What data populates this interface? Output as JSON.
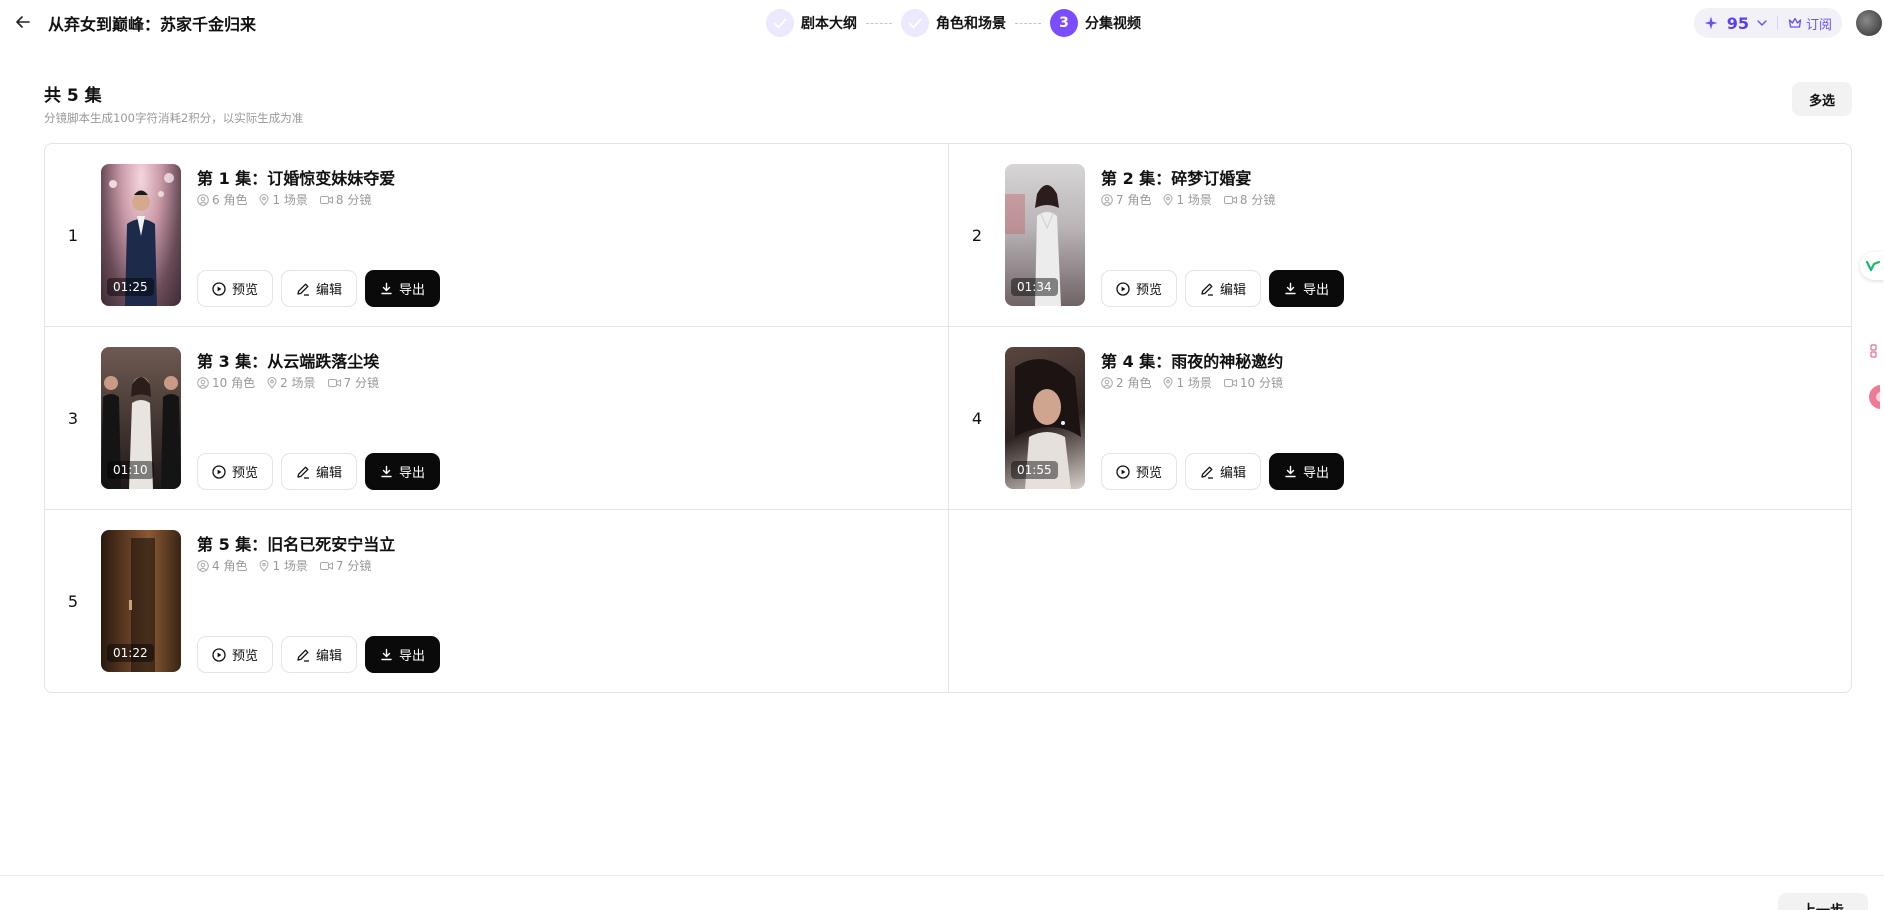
{
  "header": {
    "title": "从弃女到巅峰：苏家千金归来",
    "steps": [
      {
        "label": "剧本大纲",
        "status": "done"
      },
      {
        "label": "角色和场景",
        "status": "done"
      },
      {
        "label": "分集视频",
        "number": "3",
        "status": "active"
      }
    ],
    "credits": "95",
    "subscribe_label": "订阅",
    "accent_color": "#7c4dff"
  },
  "summary": {
    "title": "共 5 集",
    "subtitle": "分镜脚本生成100字符消耗2积分，以实际生成为准",
    "multi_select_label": "多选"
  },
  "buttons": {
    "preview": "预览",
    "edit": "编辑",
    "export": "导出"
  },
  "episodes": [
    {
      "num": "1",
      "title": "第 1 集：订婚惊变妹妹夺爱",
      "roles": "6 角色",
      "scenes": "1 场景",
      "shots": "8 分镜",
      "duration": "01:25"
    },
    {
      "num": "2",
      "title": "第 2 集：碎梦订婚宴",
      "roles": "7 角色",
      "scenes": "1 场景",
      "shots": "8 分镜",
      "duration": "01:34"
    },
    {
      "num": "3",
      "title": "第 3 集：从云端跌落尘埃",
      "roles": "10 角色",
      "scenes": "2 场景",
      "shots": "7 分镜",
      "duration": "01:10"
    },
    {
      "num": "4",
      "title": "第 4 集：雨夜的神秘邀约",
      "roles": "2 角色",
      "scenes": "1 场景",
      "shots": "10 分镜",
      "duration": "01:55"
    },
    {
      "num": "5",
      "title": "第 5 集：旧名已死安宁当立",
      "roles": "4 角色",
      "scenes": "1 场景",
      "shots": "7 分镜",
      "duration": "01:22"
    }
  ],
  "footer": {
    "next_label": "上一步"
  }
}
